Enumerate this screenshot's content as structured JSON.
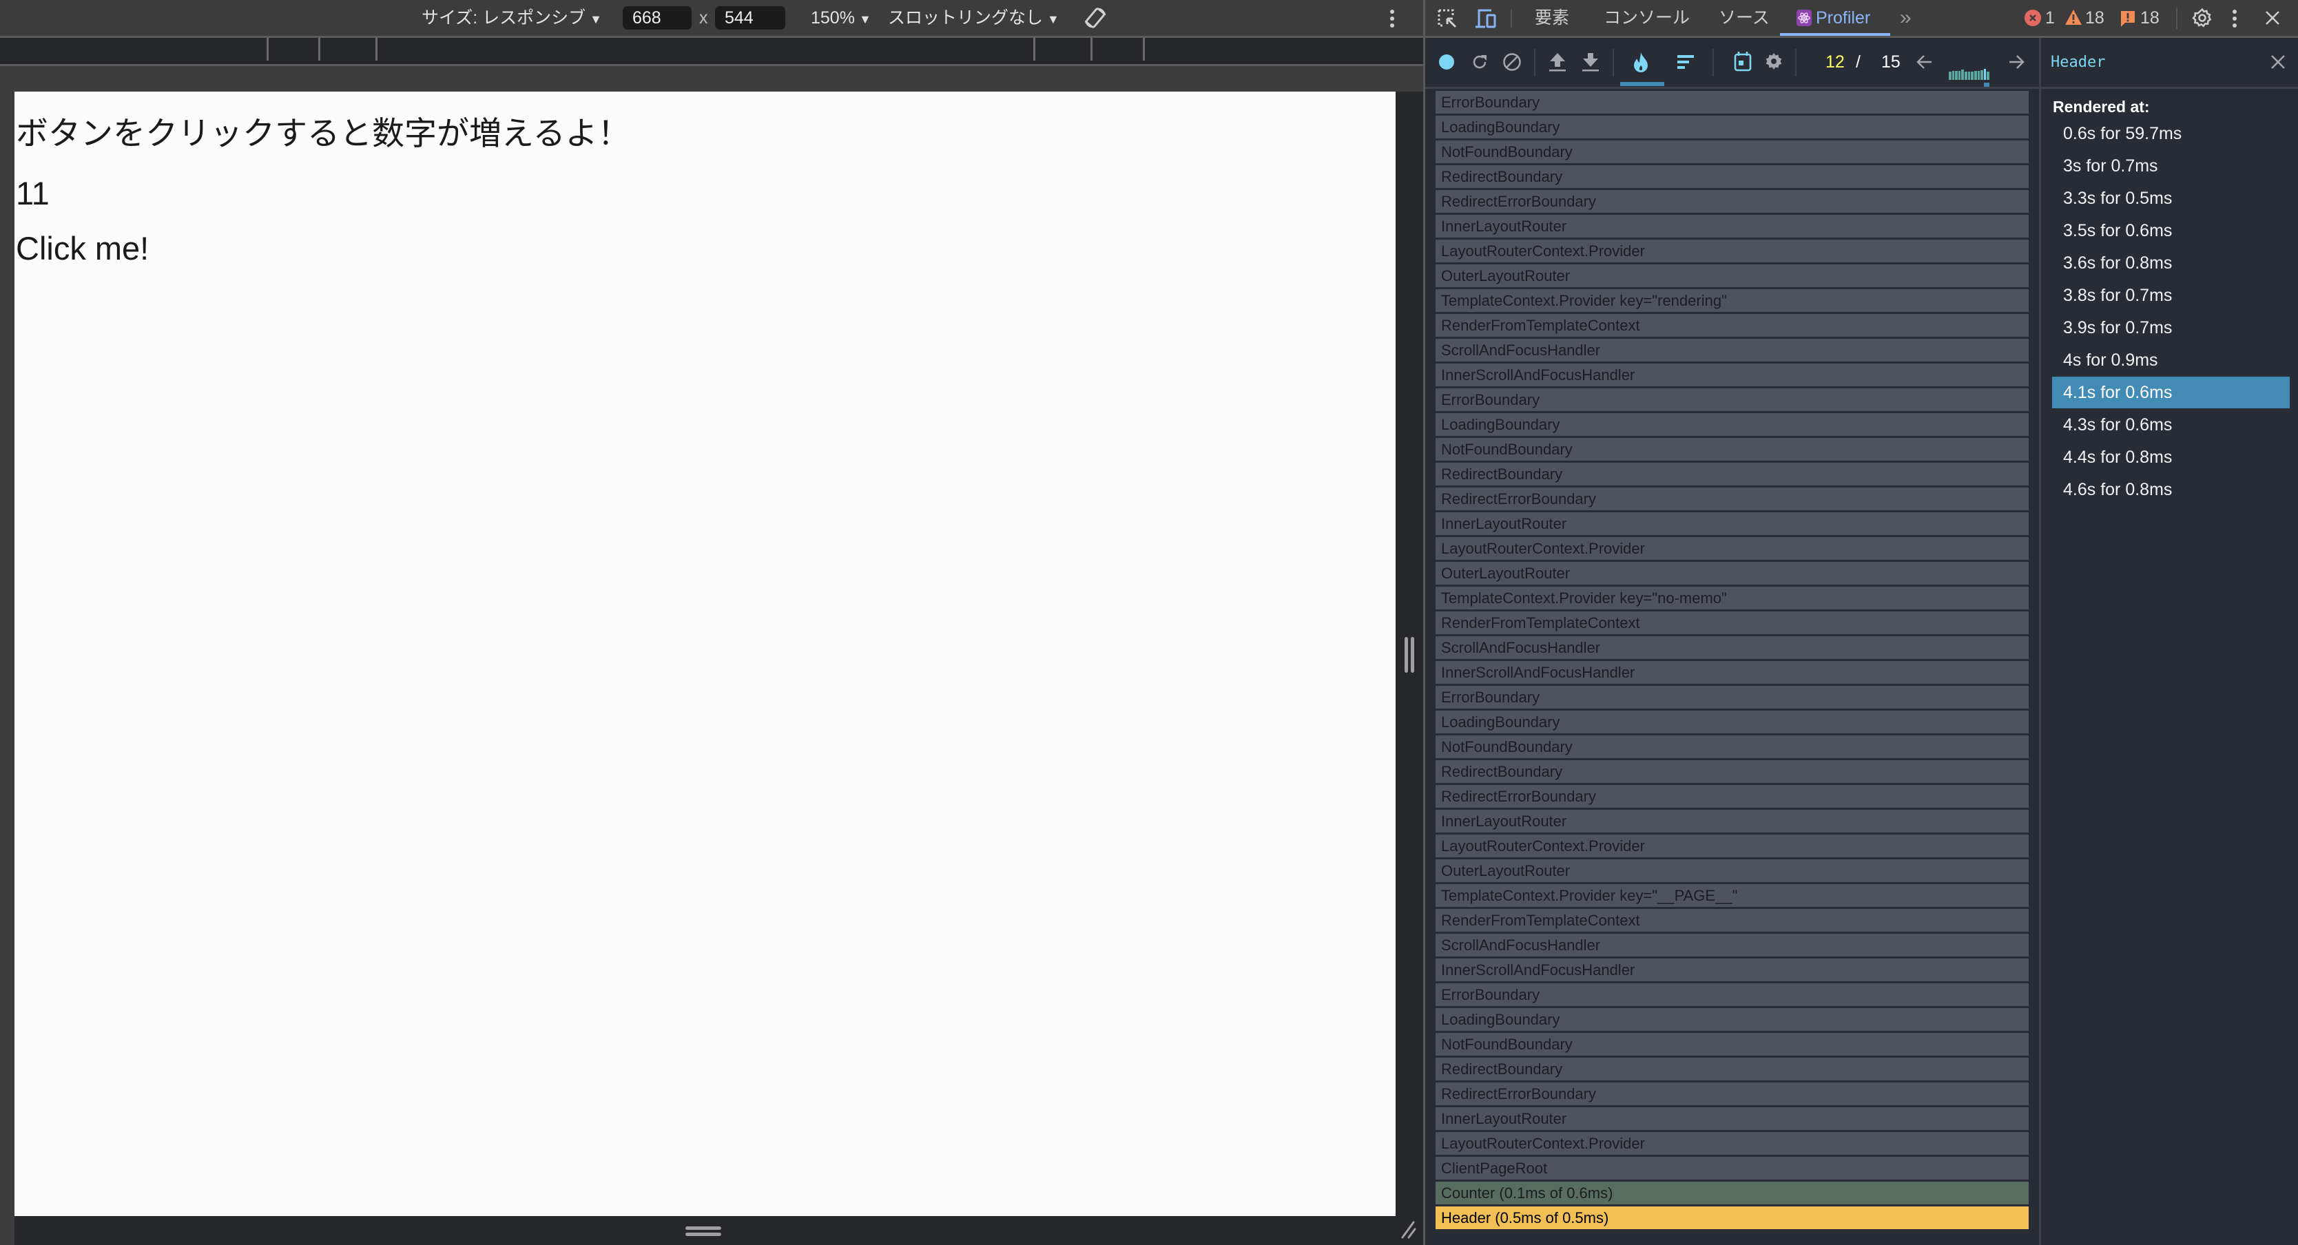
{
  "device_toolbar": {
    "size_label": "サイズ: レスポンシブ",
    "width_value": "668",
    "times": "x",
    "height_value": "544",
    "zoom": "150%",
    "throttling": "スロットリングなし"
  },
  "page": {
    "heading": "ボタンをクリックすると数字が増えるよ！",
    "count": "11",
    "button_label": "Click me!"
  },
  "devtools": {
    "tabs": [
      {
        "label": "要素"
      },
      {
        "label": "コンソール"
      },
      {
        "label": "ソース"
      },
      {
        "label": "Profiler",
        "active": true
      }
    ],
    "more_tabs": "»",
    "errors": "1",
    "warnings": "18",
    "issues": "18"
  },
  "profiler": {
    "commit_current": "12",
    "commit_separator": "/",
    "commit_total": "15",
    "commit_bars": [
      0.55,
      0.6,
      0.6,
      0.6,
      0.7,
      0.55,
      0.55,
      0.55,
      0.6,
      0.6,
      0.65,
      0.75,
      0.55
    ],
    "selected_commit_index": 11,
    "flame_rows": [
      {
        "label": "ErrorBoundary"
      },
      {
        "label": "LoadingBoundary"
      },
      {
        "label": "NotFoundBoundary"
      },
      {
        "label": "RedirectBoundary"
      },
      {
        "label": "RedirectErrorBoundary"
      },
      {
        "label": "InnerLayoutRouter"
      },
      {
        "label": "LayoutRouterContext.Provider"
      },
      {
        "label": "OuterLayoutRouter"
      },
      {
        "label": "TemplateContext.Provider key=\"rendering\""
      },
      {
        "label": "RenderFromTemplateContext"
      },
      {
        "label": "ScrollAndFocusHandler"
      },
      {
        "label": "InnerScrollAndFocusHandler"
      },
      {
        "label": "ErrorBoundary"
      },
      {
        "label": "LoadingBoundary"
      },
      {
        "label": "NotFoundBoundary"
      },
      {
        "label": "RedirectBoundary"
      },
      {
        "label": "RedirectErrorBoundary"
      },
      {
        "label": "InnerLayoutRouter"
      },
      {
        "label": "LayoutRouterContext.Provider"
      },
      {
        "label": "OuterLayoutRouter"
      },
      {
        "label": "TemplateContext.Provider key=\"no-memo\""
      },
      {
        "label": "RenderFromTemplateContext"
      },
      {
        "label": "ScrollAndFocusHandler"
      },
      {
        "label": "InnerScrollAndFocusHandler"
      },
      {
        "label": "ErrorBoundary"
      },
      {
        "label": "LoadingBoundary"
      },
      {
        "label": "NotFoundBoundary"
      },
      {
        "label": "RedirectBoundary"
      },
      {
        "label": "RedirectErrorBoundary"
      },
      {
        "label": "InnerLayoutRouter"
      },
      {
        "label": "LayoutRouterContext.Provider"
      },
      {
        "label": "OuterLayoutRouter"
      },
      {
        "label": "TemplateContext.Provider key=\"__PAGE__\""
      },
      {
        "label": "RenderFromTemplateContext"
      },
      {
        "label": "ScrollAndFocusHandler"
      },
      {
        "label": "InnerScrollAndFocusHandler"
      },
      {
        "label": "ErrorBoundary"
      },
      {
        "label": "LoadingBoundary"
      },
      {
        "label": "NotFoundBoundary"
      },
      {
        "label": "RedirectBoundary"
      },
      {
        "label": "RedirectErrorBoundary"
      },
      {
        "label": "InnerLayoutRouter"
      },
      {
        "label": "LayoutRouterContext.Provider"
      },
      {
        "label": "ClientPageRoot"
      },
      {
        "label": "Counter (0.1ms of 0.6ms)",
        "color": "#566d5f"
      },
      {
        "label": "Header (0.5ms of 0.5ms)",
        "color": "#f2bf56",
        "selected": true
      }
    ]
  },
  "sidebar": {
    "title": "Header",
    "rendered_at_label": "Rendered at:",
    "renders": [
      {
        "label": "0.6s for 59.7ms"
      },
      {
        "label": "3s for 0.7ms"
      },
      {
        "label": "3.3s for 0.5ms"
      },
      {
        "label": "3.5s for 0.6ms"
      },
      {
        "label": "3.6s for 0.8ms"
      },
      {
        "label": "3.8s for 0.7ms"
      },
      {
        "label": "3.9s for 0.7ms"
      },
      {
        "label": "4s for 0.9ms"
      },
      {
        "label": "4.1s for 0.6ms",
        "selected": true
      },
      {
        "label": "4.3s for 0.6ms"
      },
      {
        "label": "4.4s for 0.8ms"
      },
      {
        "label": "4.6s for 0.8ms"
      }
    ]
  },
  "colors": {
    "accent_blue": "#7dd6f4",
    "selected_blue": "#428bb5",
    "commit_yellow": "#ffff66",
    "counter_green": "#566d5f",
    "header_yellow": "#f2bf56",
    "error_red": "#e46962",
    "warning_orange": "#f28b54"
  }
}
